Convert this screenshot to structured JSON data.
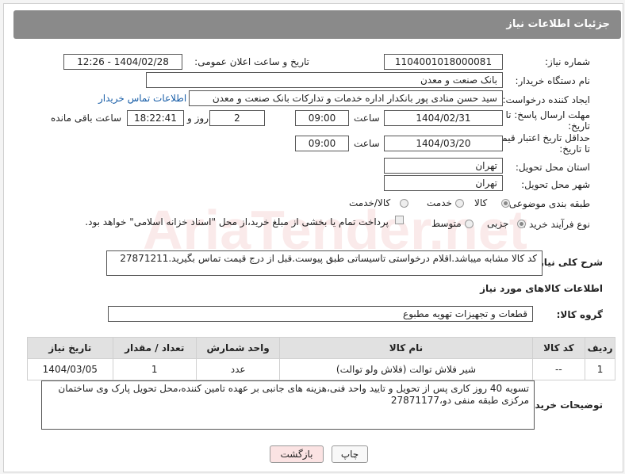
{
  "header": {
    "title": "جزئیات اطلاعات نیاز"
  },
  "fields": {
    "need_number_label": "شماره نیاز:",
    "need_number": "1104001018000081",
    "announce_label": "تاریخ و ساعت اعلان عمومی:",
    "announce_value": "1404/02/28 - 12:26",
    "buyer_org_label": "نام دستگاه خریدار:",
    "buyer_org": "بانک صنعت و معدن",
    "requester_label": "ایجاد کننده درخواست:",
    "requester": "سید حسن منادی پور بانکدار اداره خدمات و تدارکات بانک صنعت و معدن",
    "contact_link": "اطلاعات تماس خریدار",
    "deadline_label_1": "مهلت ارسال پاسخ: تا",
    "deadline_label_2": "تاریخ:",
    "deadline_date": "1404/02/31",
    "time_label": "ساعت",
    "deadline_time": "09:00",
    "days_value": "2",
    "days_label": "روز و",
    "remaining_time": "18:22:41",
    "remaining_label": "ساعت باقی مانده",
    "validity_label_1": "حداقل تاریخ اعتبار قیمت:",
    "validity_label_2": "تا تاریخ:",
    "validity_date": "1404/03/20",
    "validity_time": "09:00",
    "province_label": "استان محل تحویل:",
    "province": "تهران",
    "city_label": "شهر محل تحویل:",
    "city": "تهران",
    "category_label": "طبقه بندی موضوعی:",
    "category_options": [
      "کالا",
      "خدمت",
      "کالا/خدمت"
    ],
    "process_label": "نوع فرآیند خرید :",
    "process_options": [
      "جزیی",
      "متوسط"
    ],
    "payment_note": "پرداخت تمام یا بخشی از مبلغ خرید،از محل \"اسناد خزانه اسلامی\" خواهد بود.",
    "description_label": "شرح کلی نیاز:",
    "description": "کد کالا مشابه میباشد.اقلام درخواستی تاسیساتی طبق پیوست.قبل از درج قیمت تماس بگیرید.27871211",
    "goods_info_title": "اطلاعات کالاهای مورد نیاز",
    "goods_group_label": "گروه کالا:",
    "goods_group": "قطعات و تجهیزات تهویه مطبوع",
    "buyer_notes_label": "توضیحات خریدار:",
    "buyer_notes": "تسویه 40 روز کاری پس از تحویل و تایید واحد فنی،هزینه های جانبی بر عهده تامین کننده،محل تحویل پارک وی ساختمان مرکزی طبقه منفی دو،27871177"
  },
  "table": {
    "headers": [
      "ردیف",
      "کد کالا",
      "نام کالا",
      "واحد شمارش",
      "تعداد / مقدار",
      "تاریخ نیاز"
    ],
    "rows": [
      [
        "1",
        "--",
        "شیر فلاش توالت (فلاش ولو توالت)",
        "عدد",
        "1",
        "1404/03/05"
      ]
    ]
  },
  "buttons": {
    "print": "چاپ",
    "back": "بازگشت"
  },
  "watermark": "AriaTender.net",
  "colors": {
    "header_bg": "#8a8a8a",
    "link": "#1a5fa8",
    "back_button_bg": "#fbe3e3"
  }
}
